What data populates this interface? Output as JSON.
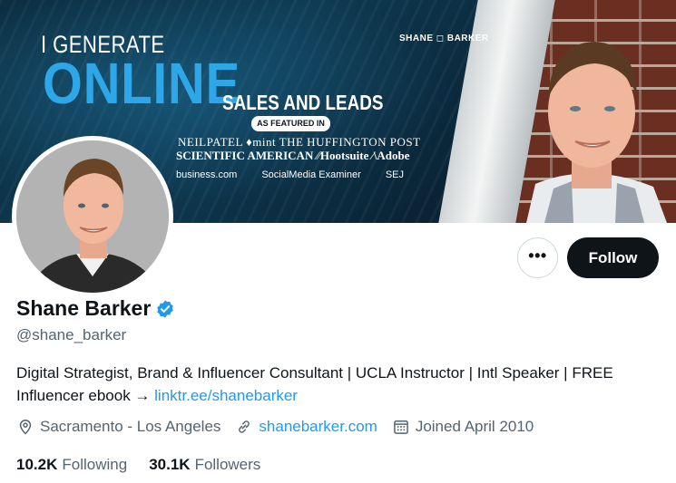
{
  "banner": {
    "headline_line1": "I GENERATE",
    "headline_line2": "ONLINE",
    "headline_line3": "SALES AND LEADS",
    "featured_label": "AS FEATURED IN",
    "press_row1": "NEILPATEL  ♦mint  THE HUFFINGTON POST",
    "press_row2": "SCIENTIFIC AMERICAN   ⁄⁄Hootsuite   ⁄\\Adobe",
    "press_row3": [
      "business.com",
      "SocialMedia Examiner",
      "SEJ"
    ],
    "brand_tag": "SHANE ◻ BARKER"
  },
  "profile": {
    "name": "Shane Barker",
    "handle": "@shane_barker",
    "bio_text": "Digital Strategist, Brand & Influencer Consultant | UCLA Instructor | Intl Speaker | FREE Influencer ebook → ",
    "bio_link": "linktr.ee/shanebarker",
    "location": "Sacramento - Los Angeles",
    "website": "shanebarker.com",
    "joined": "Joined April 2010",
    "following_count": "10.2K",
    "following_label": "Following",
    "followers_count": "30.1K",
    "followers_label": "Followers"
  },
  "actions": {
    "more_label": "•••",
    "follow_label": "Follow"
  },
  "colors": {
    "accent": "#1d9bf0",
    "text_primary": "#0f1419",
    "text_secondary": "#536471",
    "headline_blue": "#2ea7e8"
  },
  "icons": [
    "more-options-icon",
    "verified-badge-icon",
    "location-icon",
    "link-icon",
    "calendar-icon"
  ]
}
